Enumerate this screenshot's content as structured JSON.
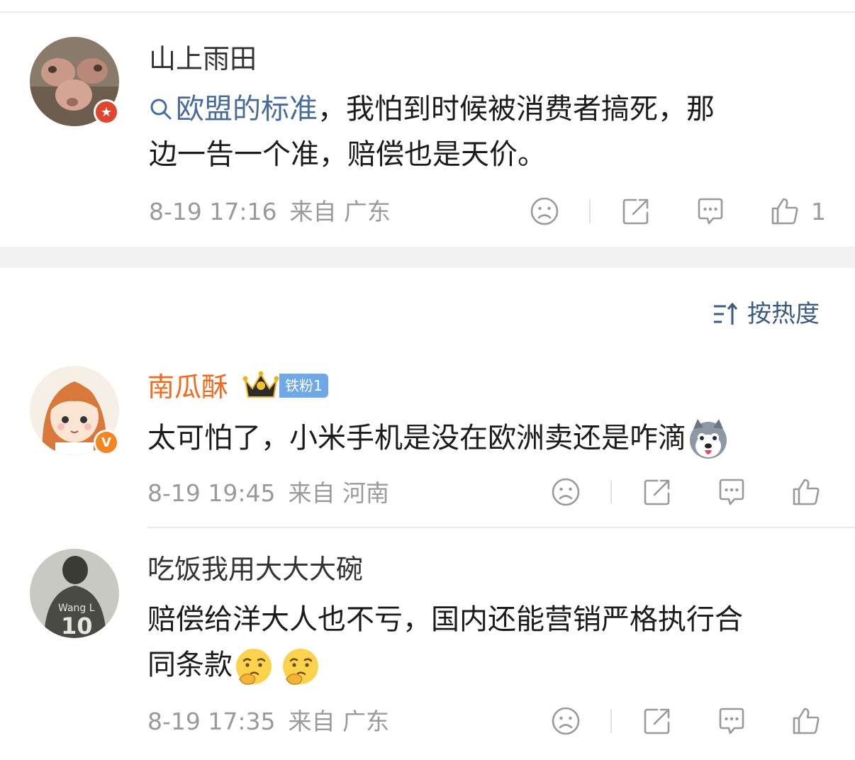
{
  "sort": {
    "label": "按热度"
  },
  "comments": [
    {
      "username": "山上雨田",
      "topic": "欧盟的标准",
      "text_line1": "，我怕到时候被消费者搞死，那",
      "text_line2": "边一告一个准，赔偿也是天价。",
      "time": "8-19 17:16",
      "location": "来自 广东",
      "likes": "1",
      "badge": "red-star-badge"
    },
    {
      "username": "南瓜酥",
      "fan_badge": "铁粉1",
      "text_line1": "太可怕了，小米手机是没在欧洲卖还是咋滴",
      "time": "8-19 19:45",
      "location": "来自 河南",
      "likes": "",
      "badge": "orange-v-badge",
      "v_label": "V"
    },
    {
      "username": "吃饭我用大大大碗",
      "text_line1": "赔偿给洋大人也不亏，国内还能营销严格执行合",
      "text_line2": "同条款",
      "time": "8-19 17:35",
      "location": "来自 广东",
      "likes": "",
      "jersey_text": "Wang L",
      "jersey_number": "10"
    }
  ],
  "colors": {
    "topic": "#486b9e",
    "vip_name": "#f26b1d",
    "meta": "#9a9a9a",
    "badge_red": "#e0452f",
    "badge_orange": "#f5861f",
    "fan_tag": "#6fa8e8"
  }
}
